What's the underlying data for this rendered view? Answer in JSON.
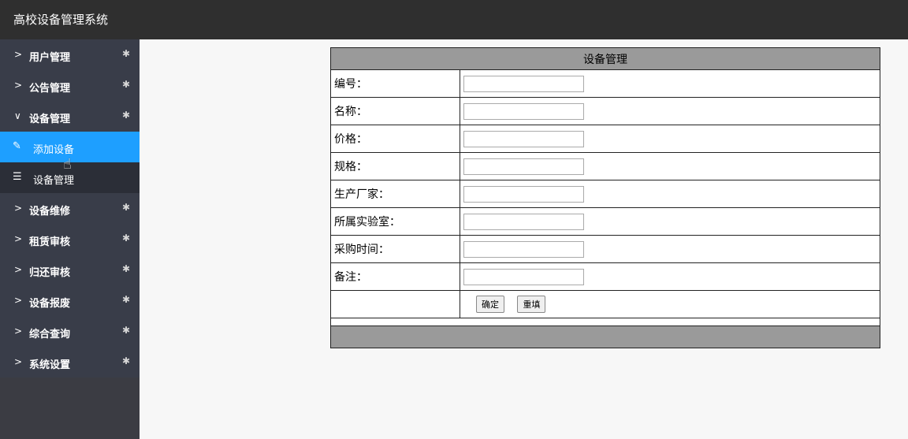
{
  "header": {
    "title": "高校设备管理系统"
  },
  "sidebar": {
    "items_top": [
      {
        "label": "用户管理"
      },
      {
        "label": "公告管理"
      },
      {
        "label": "设备管理"
      }
    ],
    "sub_items": [
      {
        "label": "添加设备",
        "icon": "pencil-icon",
        "active": true
      },
      {
        "label": "设备管理",
        "icon": "list-icon",
        "active": false
      }
    ],
    "items_bottom": [
      {
        "label": "设备维修"
      },
      {
        "label": "租赁审核"
      },
      {
        "label": "归还审核"
      },
      {
        "label": "设备报废"
      },
      {
        "label": "综合查询"
      },
      {
        "label": "系统设置"
      }
    ]
  },
  "form": {
    "title": "设备管理",
    "fields": [
      {
        "label": "编号：",
        "value": ""
      },
      {
        "label": "名称：",
        "value": ""
      },
      {
        "label": "价格：",
        "value": ""
      },
      {
        "label": "规格：",
        "value": ""
      },
      {
        "label": "生产厂家：",
        "value": ""
      },
      {
        "label": "所属实验室：",
        "value": ""
      },
      {
        "label": "采购时间：",
        "value": ""
      },
      {
        "label": "备注：",
        "value": ""
      }
    ],
    "submit_label": "确定",
    "reset_label": "重填"
  }
}
